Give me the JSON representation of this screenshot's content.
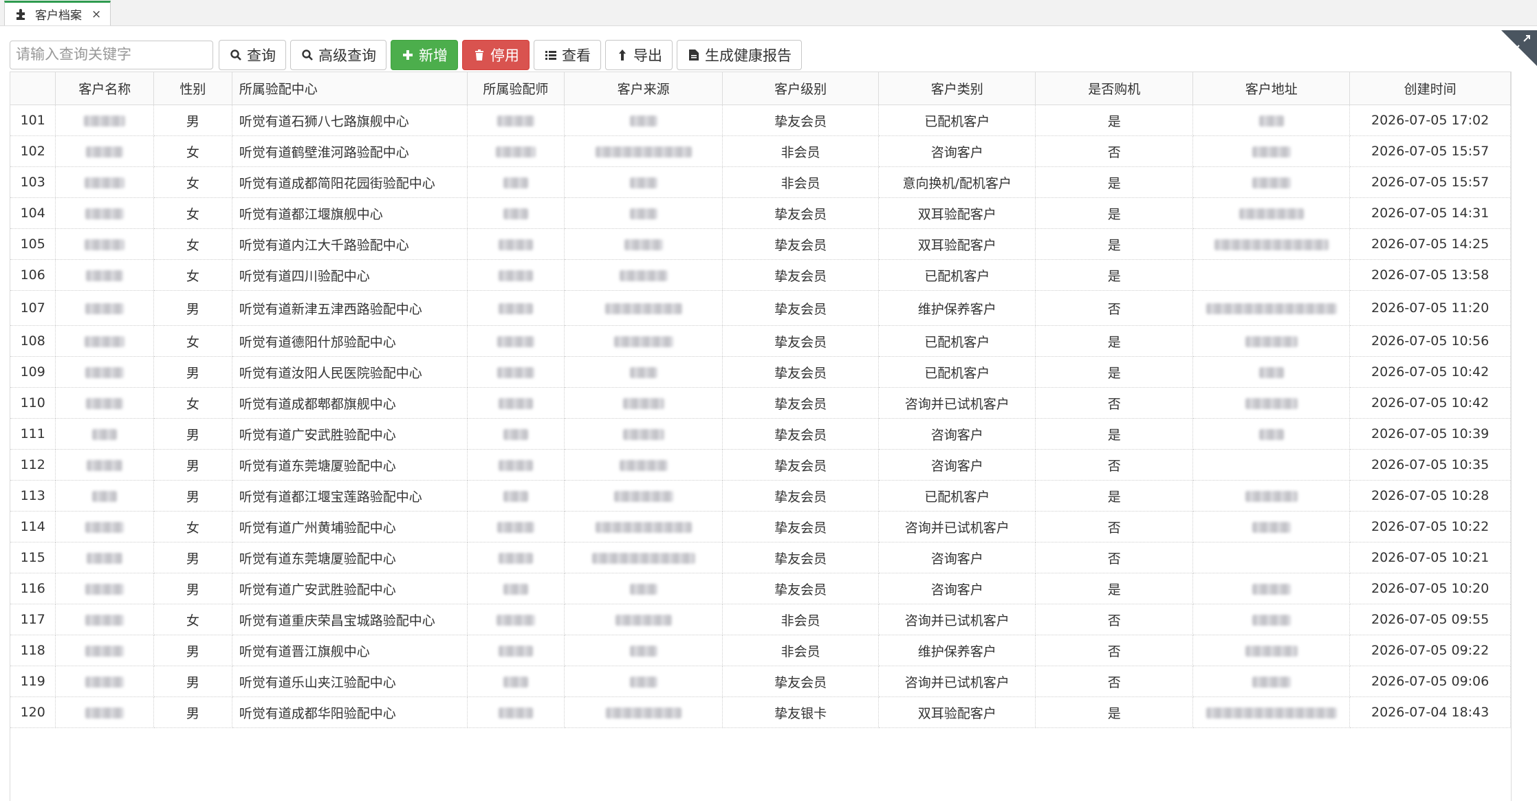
{
  "tab": {
    "title": "客户档案",
    "close": "×"
  },
  "toolbar": {
    "search_placeholder": "请输入查询关键字",
    "buttons": [
      {
        "label": "查询",
        "icon": "search-icon"
      },
      {
        "label": "高级查询",
        "icon": "search-icon"
      },
      {
        "label": "新增",
        "icon": "plus-icon"
      },
      {
        "label": "停用",
        "icon": "trash-icon"
      },
      {
        "label": "查看",
        "icon": "list-icon"
      },
      {
        "label": "导出",
        "icon": "export-icon"
      },
      {
        "label": "生成健康报告",
        "icon": "document-icon"
      }
    ]
  },
  "table": {
    "headers": [
      "客户名称",
      "性别",
      "所属验配中心",
      "所属验配师",
      "客户来源",
      "客户级别",
      "客户类别",
      "是否购机",
      "客户地址",
      "创建时间"
    ],
    "rows": [
      {
        "no": "101",
        "gender": "男",
        "center": "听觉有道石狮八七路旗舰中心",
        "level": "挚友会员",
        "category": "已配机客户",
        "bought": "是",
        "created": "2026-07-05 17:02"
      },
      {
        "no": "102",
        "gender": "女",
        "center": "听觉有道鹤壁淮河路验配中心",
        "level": "非会员",
        "category": "咨询客户",
        "bought": "否",
        "created": "2026-07-05 15:57"
      },
      {
        "no": "103",
        "gender": "女",
        "center": "听觉有道成都简阳花园街验配中心",
        "level": "非会员",
        "category": "意向换机/配机客户",
        "bought": "是",
        "created": "2026-07-05 15:57"
      },
      {
        "no": "104",
        "gender": "女",
        "center": "听觉有道都江堰旗舰中心",
        "level": "挚友会员",
        "category": "双耳验配客户",
        "bought": "是",
        "created": "2026-07-05 14:31"
      },
      {
        "no": "105",
        "gender": "女",
        "center": "听觉有道内江大千路验配中心",
        "level": "挚友会员",
        "category": "双耳验配客户",
        "bought": "是",
        "created": "2026-07-05 14:25"
      },
      {
        "no": "106",
        "gender": "女",
        "center": "听觉有道四川验配中心",
        "level": "挚友会员",
        "category": "已配机客户",
        "bought": "是",
        "created": "2026-07-05 13:58"
      },
      {
        "no": "107",
        "gender": "男",
        "center": "听觉有道新津五津西路验配中心",
        "level": "挚友会员",
        "category": "维护保养客户",
        "bought": "否",
        "created": "2026-07-05 11:20"
      },
      {
        "no": "108",
        "gender": "女",
        "center": "听觉有道德阳什邡验配中心",
        "level": "挚友会员",
        "category": "已配机客户",
        "bought": "是",
        "created": "2026-07-05 10:56"
      },
      {
        "no": "109",
        "gender": "男",
        "center": "听觉有道汝阳人民医院验配中心",
        "level": "挚友会员",
        "category": "已配机客户",
        "bought": "是",
        "created": "2026-07-05 10:42"
      },
      {
        "no": "110",
        "gender": "女",
        "center": "听觉有道成都郫都旗舰中心",
        "level": "挚友会员",
        "category": "咨询并已试机客户",
        "bought": "否",
        "created": "2026-07-05 10:42"
      },
      {
        "no": "111",
        "gender": "男",
        "center": "听觉有道广安武胜验配中心",
        "level": "挚友会员",
        "category": "咨询客户",
        "bought": "是",
        "created": "2026-07-05 10:39"
      },
      {
        "no": "112",
        "gender": "男",
        "center": "听觉有道东莞塘厦验配中心",
        "level": "挚友会员",
        "category": "咨询客户",
        "bought": "否",
        "created": "2026-07-05 10:35"
      },
      {
        "no": "113",
        "gender": "男",
        "center": "听觉有道都江堰宝莲路验配中心",
        "level": "挚友会员",
        "category": "已配机客户",
        "bought": "是",
        "created": "2026-07-05 10:28"
      },
      {
        "no": "114",
        "gender": "女",
        "center": "听觉有道广州黄埔验配中心",
        "level": "挚友会员",
        "category": "咨询并已试机客户",
        "bought": "否",
        "created": "2026-07-05 10:22"
      },
      {
        "no": "115",
        "gender": "男",
        "center": "听觉有道东莞塘厦验配中心",
        "level": "挚友会员",
        "category": "咨询客户",
        "bought": "否",
        "created": "2026-07-05 10:21"
      },
      {
        "no": "116",
        "gender": "男",
        "center": "听觉有道广安武胜验配中心",
        "level": "挚友会员",
        "category": "咨询客户",
        "bought": "是",
        "created": "2026-07-05 10:20"
      },
      {
        "no": "117",
        "gender": "女",
        "center": "听觉有道重庆荣昌宝城路验配中心",
        "level": "非会员",
        "category": "咨询并已试机客户",
        "bought": "否",
        "created": "2026-07-05 09:55"
      },
      {
        "no": "118",
        "gender": "男",
        "center": "听觉有道晋江旗舰中心",
        "level": "非会员",
        "category": "维护保养客户",
        "bought": "否",
        "created": "2026-07-05 09:22"
      },
      {
        "no": "119",
        "gender": "男",
        "center": "听觉有道乐山夹江验配中心",
        "level": "挚友会员",
        "category": "咨询并已试机客户",
        "bought": "否",
        "created": "2026-07-05 09:06"
      },
      {
        "no": "120",
        "gender": "男",
        "center": "听觉有道成都华阳验配中心",
        "level": "挚友银卡",
        "category": "双耳验配客户",
        "bought": "是",
        "created": "2026-07-04 18:43"
      }
    ]
  }
}
